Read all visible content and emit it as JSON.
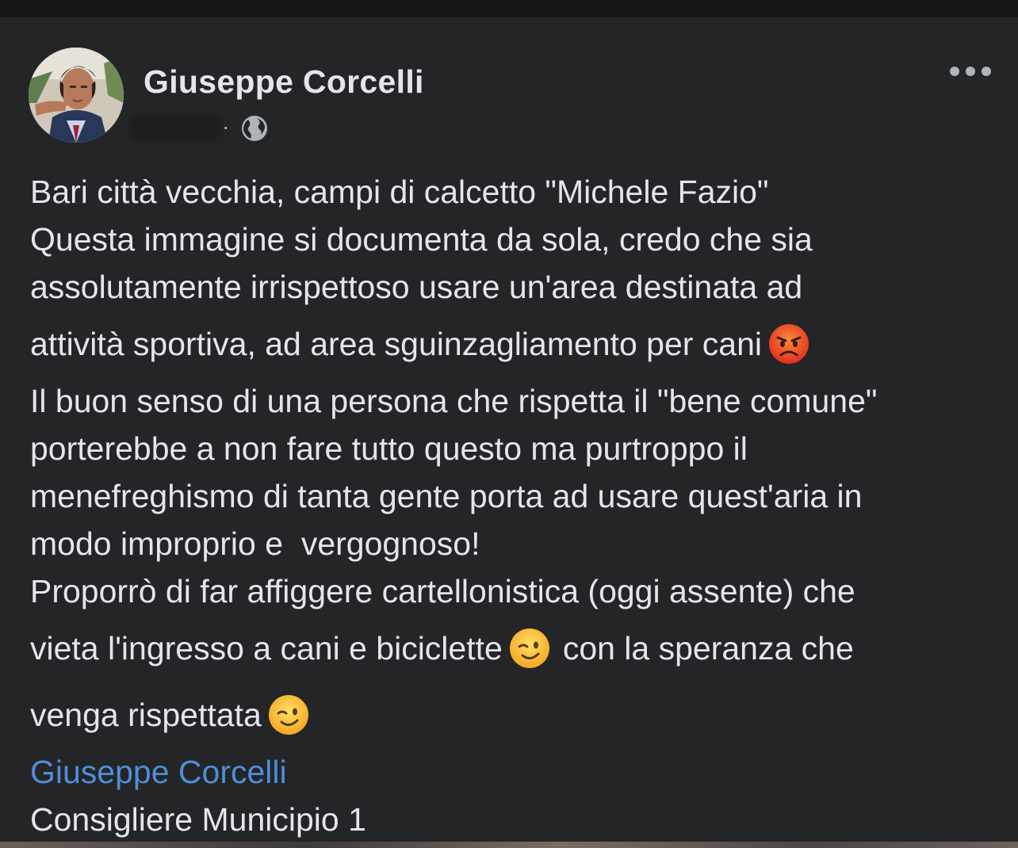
{
  "post": {
    "author_name": "Giuseppe Corcelli",
    "meta_separator": "·",
    "lines": {
      "l1": "Bari città vecchia, campi di calcetto \"Michele Fazio\"",
      "l2": "Questa immagine si documenta da sola, credo che sia",
      "l3": "assolutamente irrispettoso usare un'area destinata ad",
      "l4": "attività sportiva, ad area sguinzagliamento per cani",
      "l5": "Il buon senso di una persona che rispetta il \"bene comune\"",
      "l6": "porterebbe a non fare tutto questo ma purtroppo il",
      "l7": "menefreghismo di tanta gente porta ad usare quest'aria in",
      "l8": "modo improprio e  vergognoso!",
      "l9": "Proporrò di far affiggere cartellonistica (oggi assente) che",
      "l10a": "vieta l'ingresso a cani e biciclette",
      "l10b": "con la speranza che",
      "l11": "venga rispettata"
    },
    "signature_link": "Giuseppe Corcelli",
    "signature_title": "Consigliere Municipio 1",
    "icons": {
      "angry": "angry-face-emoji",
      "wink": "winking-face-emoji",
      "globe": "globe-icon",
      "more": "more-options-icon"
    },
    "colors": {
      "background": "#242526",
      "text": "#e4e6eb",
      "link": "#4f8ed9",
      "secondary": "#b0b3b8"
    }
  }
}
